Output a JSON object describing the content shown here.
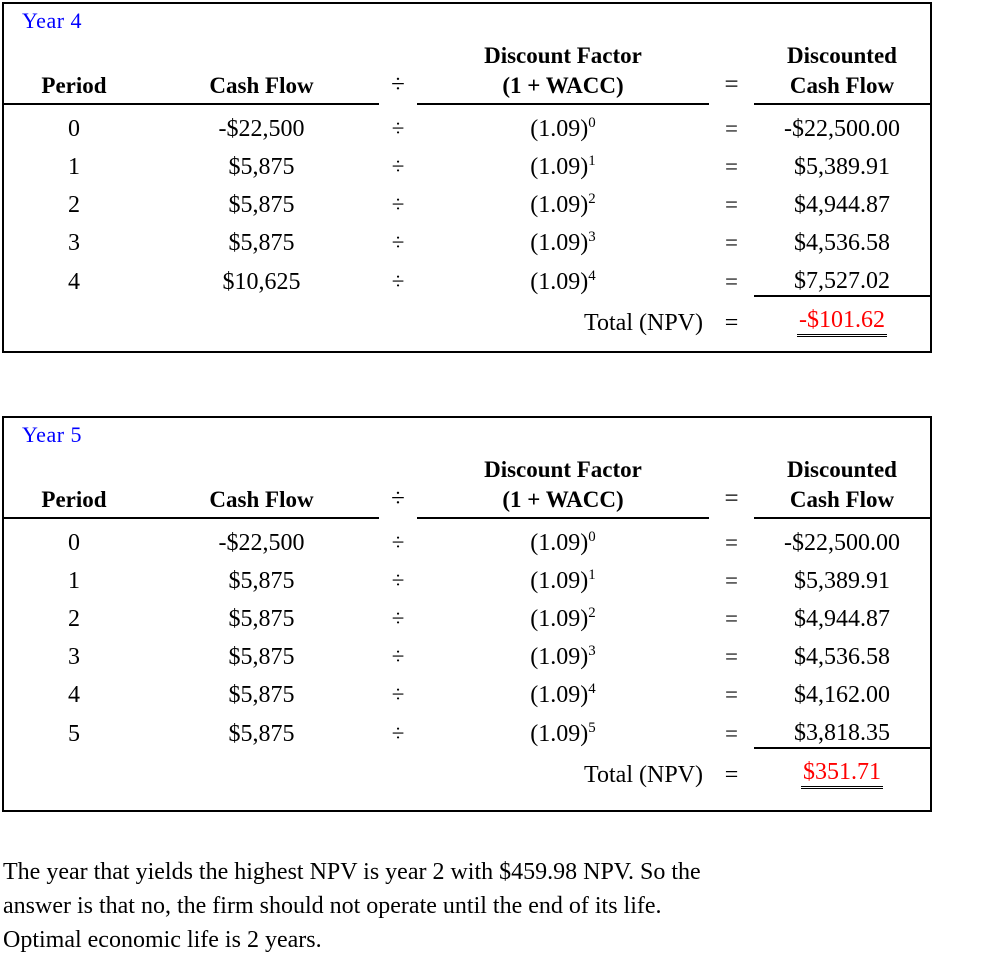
{
  "document": {
    "type": "npv-worksheet",
    "accent_blue": "#0000FF",
    "accent_red": "#FF0000"
  },
  "columns": {
    "period": "Period",
    "cash_flow": "Cash Flow",
    "divide_op": "÷",
    "discount_factor_line1": "Discount Factor",
    "discount_factor_line2": "(1 + WACC)",
    "equals_op": "=",
    "discounted_line1": "Discounted",
    "discounted_line2": "Cash Flow",
    "total_label": "Total (NPV)"
  },
  "tables": [
    {
      "year_label": "Year 4",
      "rows": [
        {
          "period": "0",
          "cash_flow": "-$22,500",
          "div": "÷",
          "base": "(1.09)",
          "exp": "0",
          "eq": "=",
          "discounted": "-$22,500.00"
        },
        {
          "period": "1",
          "cash_flow": "$5,875",
          "div": "÷",
          "base": "(1.09)",
          "exp": "1",
          "eq": "=",
          "discounted": "$5,389.91"
        },
        {
          "period": "2",
          "cash_flow": "$5,875",
          "div": "÷",
          "base": "(1.09)",
          "exp": "2",
          "eq": "=",
          "discounted": "$4,944.87"
        },
        {
          "period": "3",
          "cash_flow": "$5,875",
          "div": "÷",
          "base": "(1.09)",
          "exp": "3",
          "eq": "=",
          "discounted": "$4,536.58"
        },
        {
          "period": "4",
          "cash_flow": "$10,625",
          "div": "÷",
          "base": "(1.09)",
          "exp": "4",
          "eq": "=",
          "discounted": "$7,527.02"
        }
      ],
      "total": {
        "label": "Total (NPV)",
        "eq": "=",
        "value": "-$101.62"
      }
    },
    {
      "year_label": "Year 5",
      "rows": [
        {
          "period": "0",
          "cash_flow": "-$22,500",
          "div": "÷",
          "base": "(1.09)",
          "exp": "0",
          "eq": "=",
          "discounted": "-$22,500.00"
        },
        {
          "period": "1",
          "cash_flow": "$5,875",
          "div": "÷",
          "base": "(1.09)",
          "exp": "1",
          "eq": "=",
          "discounted": "$5,389.91"
        },
        {
          "period": "2",
          "cash_flow": "$5,875",
          "div": "÷",
          "base": "(1.09)",
          "exp": "2",
          "eq": "=",
          "discounted": "$4,944.87"
        },
        {
          "period": "3",
          "cash_flow": "$5,875",
          "div": "÷",
          "base": "(1.09)",
          "exp": "3",
          "eq": "=",
          "discounted": "$4,536.58"
        },
        {
          "period": "4",
          "cash_flow": "$5,875",
          "div": "÷",
          "base": "(1.09)",
          "exp": "4",
          "eq": "=",
          "discounted": "$4,162.00"
        },
        {
          "period": "5",
          "cash_flow": "$5,875",
          "div": "÷",
          "base": "(1.09)",
          "exp": "5",
          "eq": "=",
          "discounted": "$3,818.35"
        }
      ],
      "total": {
        "label": "Total (NPV)",
        "eq": "=",
        "value": "$351.71"
      }
    }
  ],
  "conclusion": {
    "line1": "The year that yields the highest NPV is year 2 with $459.98 NPV. So the",
    "line2": "answer is that no, the firm should not operate until the end of its life.",
    "line3": "Optimal economic life is 2 years."
  }
}
